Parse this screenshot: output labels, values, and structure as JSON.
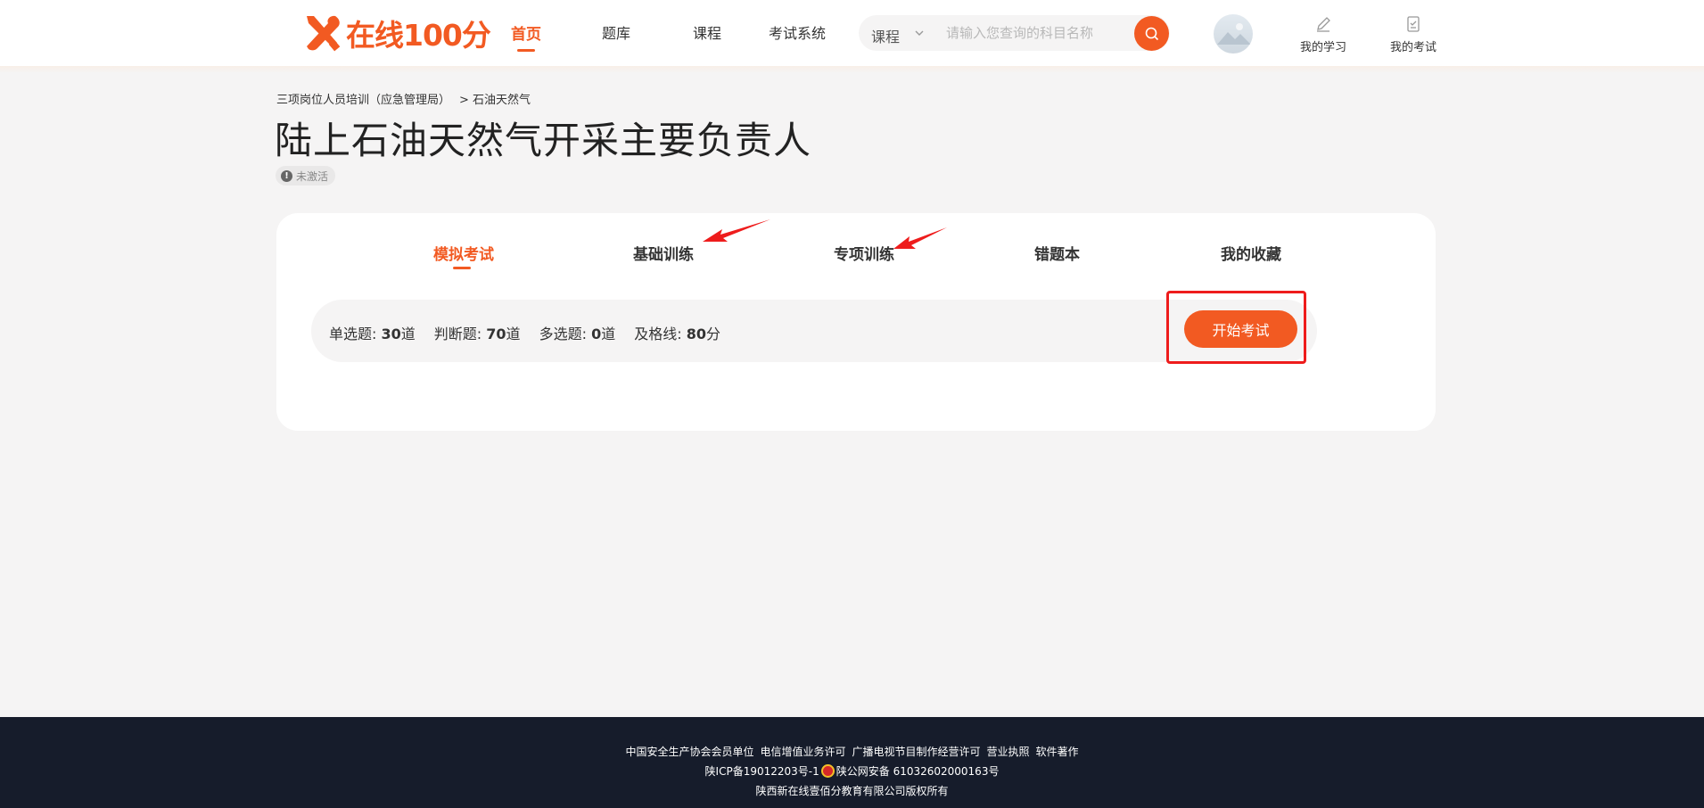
{
  "header": {
    "logo_text": "在线100分",
    "nav": [
      {
        "label": "首页",
        "active": true
      },
      {
        "label": "题库",
        "active": false
      },
      {
        "label": "课程",
        "active": false
      },
      {
        "label": "考试系统",
        "active": false
      }
    ],
    "search": {
      "category": "课程",
      "placeholder": "请输入您查询的科目名称"
    },
    "links": {
      "my_study": "我的学习",
      "my_exam": "我的考试"
    }
  },
  "breadcrumb": {
    "parent": "三项岗位人员培训（应急管理局）",
    "current": "> 石油天然气"
  },
  "page": {
    "title": "陆上石油天然气开采主要负责人",
    "status": "未激活"
  },
  "tabs": [
    {
      "label": "模拟考试",
      "active": true
    },
    {
      "label": "基础训练",
      "active": false
    },
    {
      "label": "专项训练",
      "active": false
    },
    {
      "label": "错题本",
      "active": false
    },
    {
      "label": "我的收藏",
      "active": false
    }
  ],
  "exam_info": {
    "single_choice": {
      "label": "单选题:",
      "value": "30",
      "unit": "道"
    },
    "true_false": {
      "label": "判断题:",
      "value": "70",
      "unit": "道"
    },
    "multi_choice": {
      "label": "多选题:",
      "value": "0",
      "unit": "道"
    },
    "pass_line": {
      "label": "及格线:",
      "value": "80",
      "unit": "分"
    }
  },
  "start_button": "开始考试",
  "footer": {
    "links": [
      "中国安全生产协会会员单位",
      "电信增值业务许可",
      "广播电视节目制作经营许可",
      "营业执照",
      "软件著作"
    ],
    "icp": "陕ICP备19012203号-1",
    "police": "陕公网安备 61032602000163号",
    "copyright": "陕西新在线壹佰分教育有限公司版权所有"
  },
  "colors": {
    "accent": "#f25a22",
    "annotation_red": "#ee1c1c",
    "footer_bg": "#161c2b",
    "page_bg": "#f5f4f4"
  }
}
